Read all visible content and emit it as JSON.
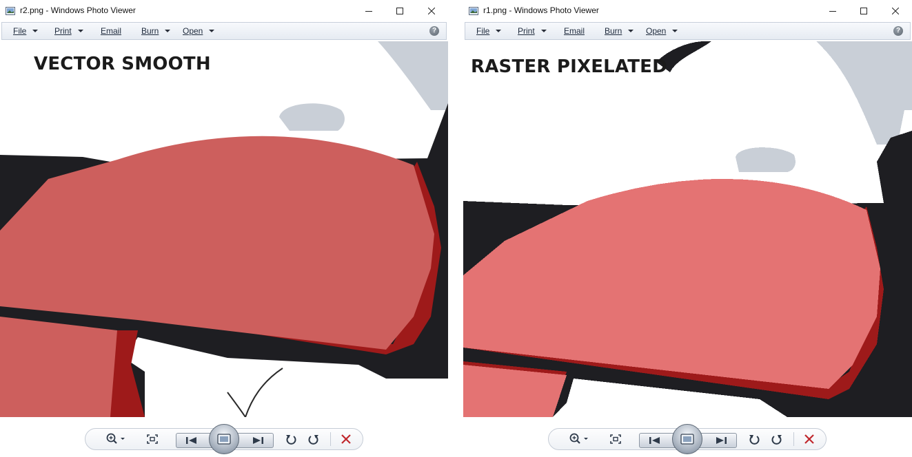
{
  "windows": [
    {
      "id": "left",
      "title": "r2.png - Windows Photo Viewer",
      "menu": [
        "File",
        "Print",
        "Email",
        "Burn",
        "Open"
      ],
      "overlay_label": "VECTOR SMOOTH"
    },
    {
      "id": "right",
      "title": "r1.png - Windows Photo Viewer",
      "menu": [
        "File",
        "Print",
        "Email",
        "Burn",
        "Open"
      ],
      "overlay_label": "RASTER PIXELATED"
    }
  ],
  "menu_has_dropdown": [
    true,
    true,
    false,
    true,
    true
  ],
  "icons": {
    "app": "photo-viewer-icon",
    "minimize": "minimize-icon",
    "maximize": "maximize-icon",
    "close": "close-icon",
    "help": "help-icon",
    "zoom": "zoom-icon",
    "actual_size": "actual-size-icon",
    "previous": "previous-icon",
    "slideshow": "slideshow-icon",
    "next": "next-icon",
    "rotate_ccw": "rotate-counterclockwise-icon",
    "rotate_cw": "rotate-clockwise-icon",
    "delete": "delete-icon"
  },
  "colors": {
    "red_fill_left": "#cd5f5d",
    "red_fill_right": "#e47373",
    "dark_red_edge": "#9e1a1a",
    "black_shape": "#1e1e22",
    "gray_shape": "#c9cfd7",
    "delete_red": "#c0282d",
    "menubar_top": "#f7f9fc",
    "menubar_bottom": "#e6ebf2"
  }
}
